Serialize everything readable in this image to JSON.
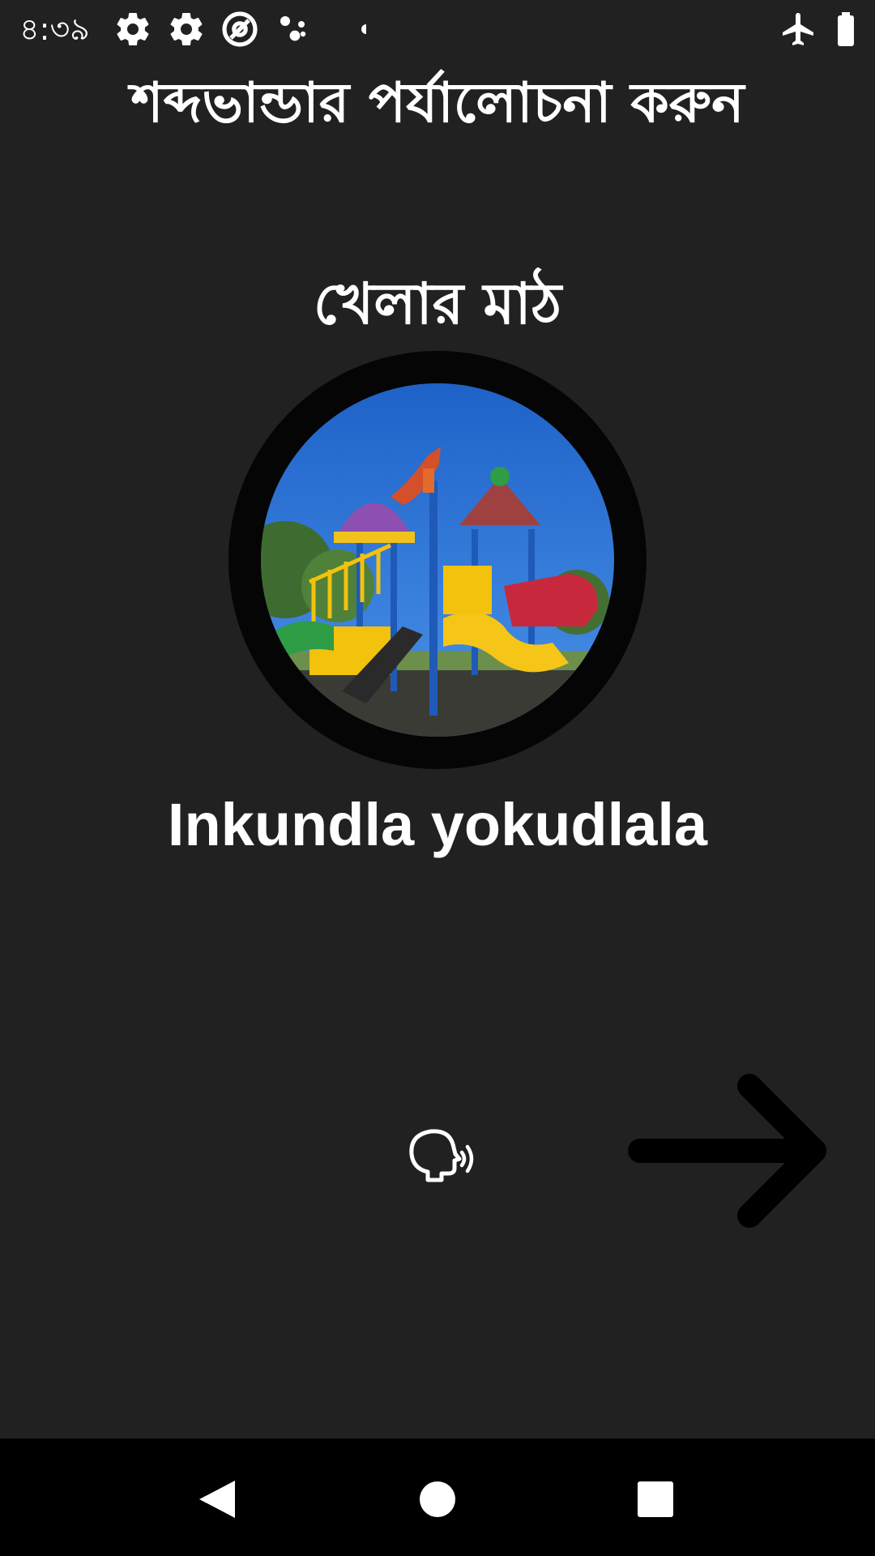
{
  "status_bar": {
    "time": "৪:৩৯",
    "left_icons": [
      "gear-icon",
      "gear-icon",
      "at-sign-icon",
      "dots-icon",
      "dot-icon"
    ],
    "right_icons": [
      "airplane-icon",
      "battery-icon"
    ]
  },
  "page_title": "শব্দভান্ডার পর্যালোচনা করুন",
  "word": {
    "native": "খেলার মাঠ",
    "translation": "Inkundla yokudlala",
    "image_icon": "playground-image"
  },
  "controls": {
    "speak_icon": "speak-icon",
    "next_icon": "arrow-right-icon"
  },
  "nav_bar": {
    "icons": [
      "back-icon",
      "home-icon",
      "recents-icon"
    ]
  },
  "colors": {
    "background": "#212121",
    "text": "#ffffff",
    "nav_background": "#000000",
    "arrow": "#000000"
  }
}
